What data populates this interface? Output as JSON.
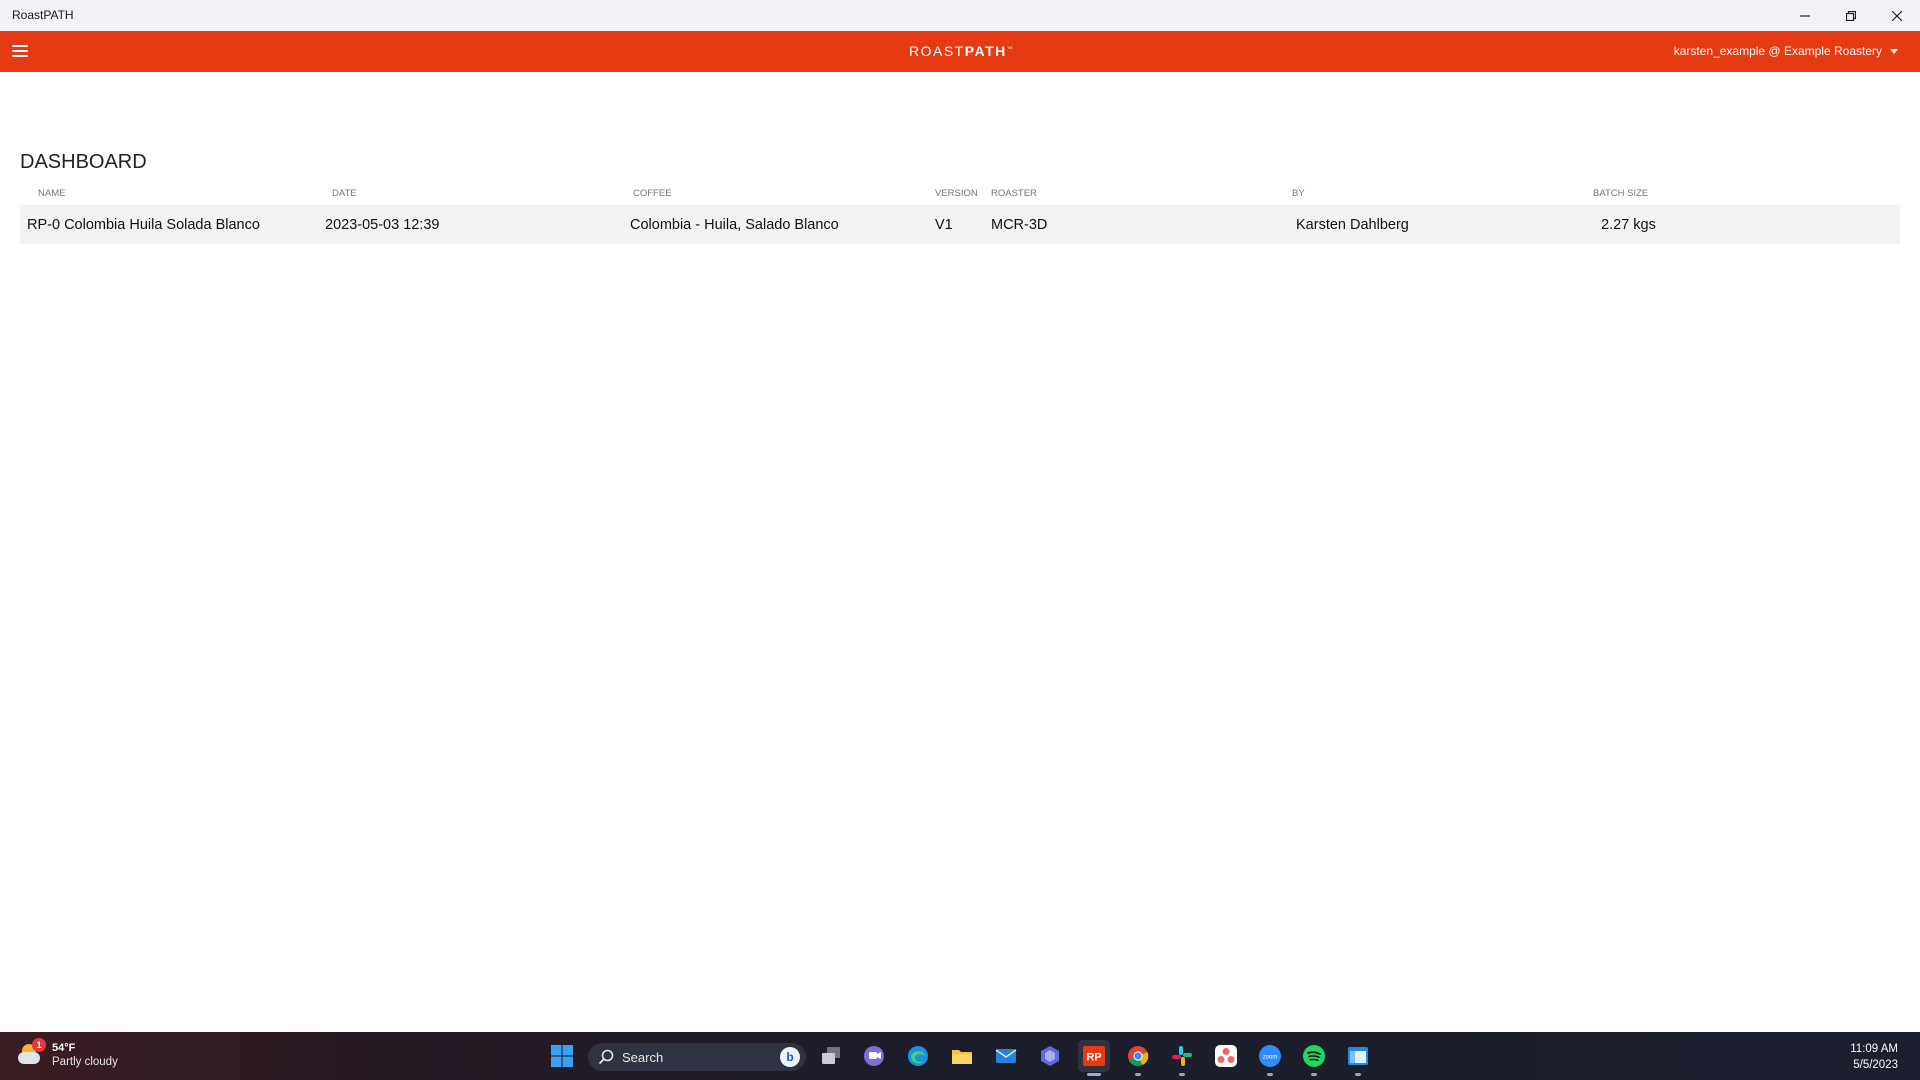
{
  "window": {
    "title": "RoastPATH"
  },
  "appbar": {
    "logo_roast": "ROAST",
    "logo_path": "PATH",
    "logo_tm": "™",
    "user_menu_label": "karsten_example @ Example Roastery",
    "accent_color": "#e63a12"
  },
  "dashboard": {
    "title": "DASHBOARD",
    "columns": [
      "NAME",
      "DATE",
      "COFFEE",
      "VERSION",
      "ROASTER",
      "BY",
      "BATCH SIZE"
    ],
    "rows": [
      {
        "name": "RP-0 Colombia Huila Solada Blanco",
        "date": "2023-05-03 12:39",
        "coffee": "Colombia - Huila, Salado Blanco",
        "version": "V1",
        "roaster": "MCR-3D",
        "by": "Karsten Dahlberg",
        "batch_size": "2.27 kgs"
      }
    ]
  },
  "taskbar": {
    "weather": {
      "temperature": "54°F",
      "description": "Partly cloudy",
      "badge": "1"
    },
    "search": {
      "placeholder": "Search"
    },
    "apps": [
      {
        "name": "start-icon"
      },
      {
        "name": "task-view-icon"
      },
      {
        "name": "teams-chat-icon"
      },
      {
        "name": "edge-icon"
      },
      {
        "name": "file-explorer-icon"
      },
      {
        "name": "mail-icon"
      },
      {
        "name": "copilot-icon"
      },
      {
        "name": "roastpath-icon",
        "label": "RP"
      },
      {
        "name": "chrome-icon"
      },
      {
        "name": "slack-icon"
      },
      {
        "name": "asana-icon"
      },
      {
        "name": "zoom-icon",
        "label": "zoom"
      },
      {
        "name": "spotify-icon"
      },
      {
        "name": "window-app-icon"
      }
    ],
    "clock": {
      "time": "11:09 AM",
      "date": "5/5/2023"
    }
  }
}
